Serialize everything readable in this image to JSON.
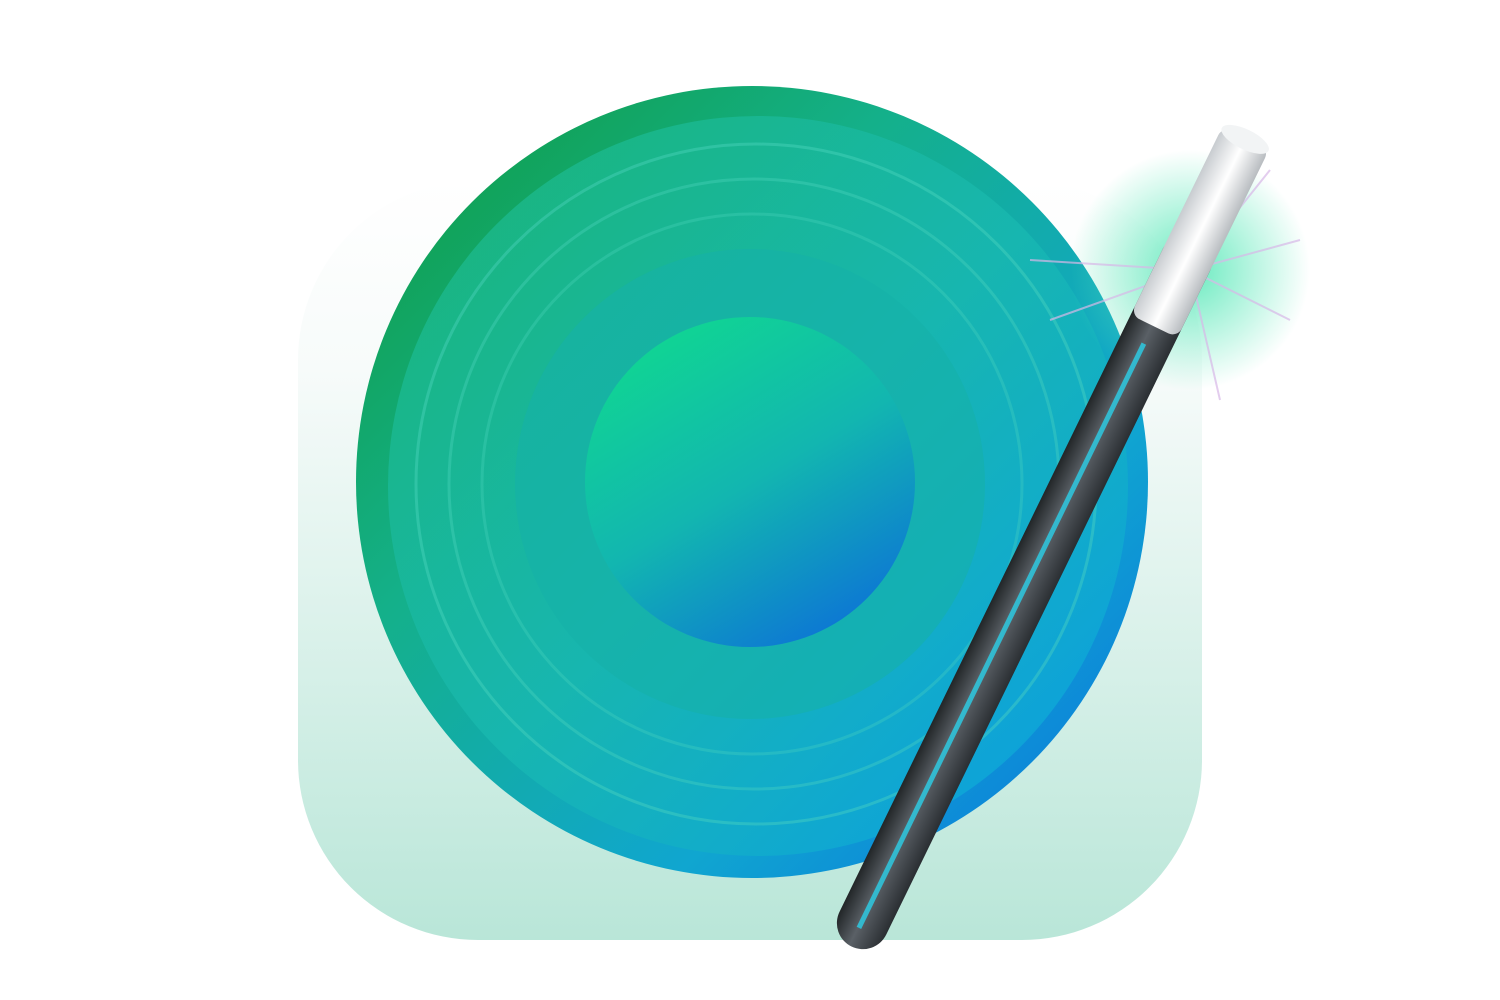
{
  "icon": {
    "subject": "speaker-with-magic-wand",
    "colors": {
      "background_top": "#ffffff",
      "background_bottom": "#bfe8dc",
      "speaker_green": "#12a24a",
      "speaker_teal": "#14b6a0",
      "speaker_blue": "#0a7fe0",
      "cone_center": "#1cc6a4",
      "wand_body": "#3a3f44",
      "wand_stripe": "#2ad0e8",
      "wand_tip": "#e6e8ea",
      "sparkle": "#38d8a8"
    }
  }
}
